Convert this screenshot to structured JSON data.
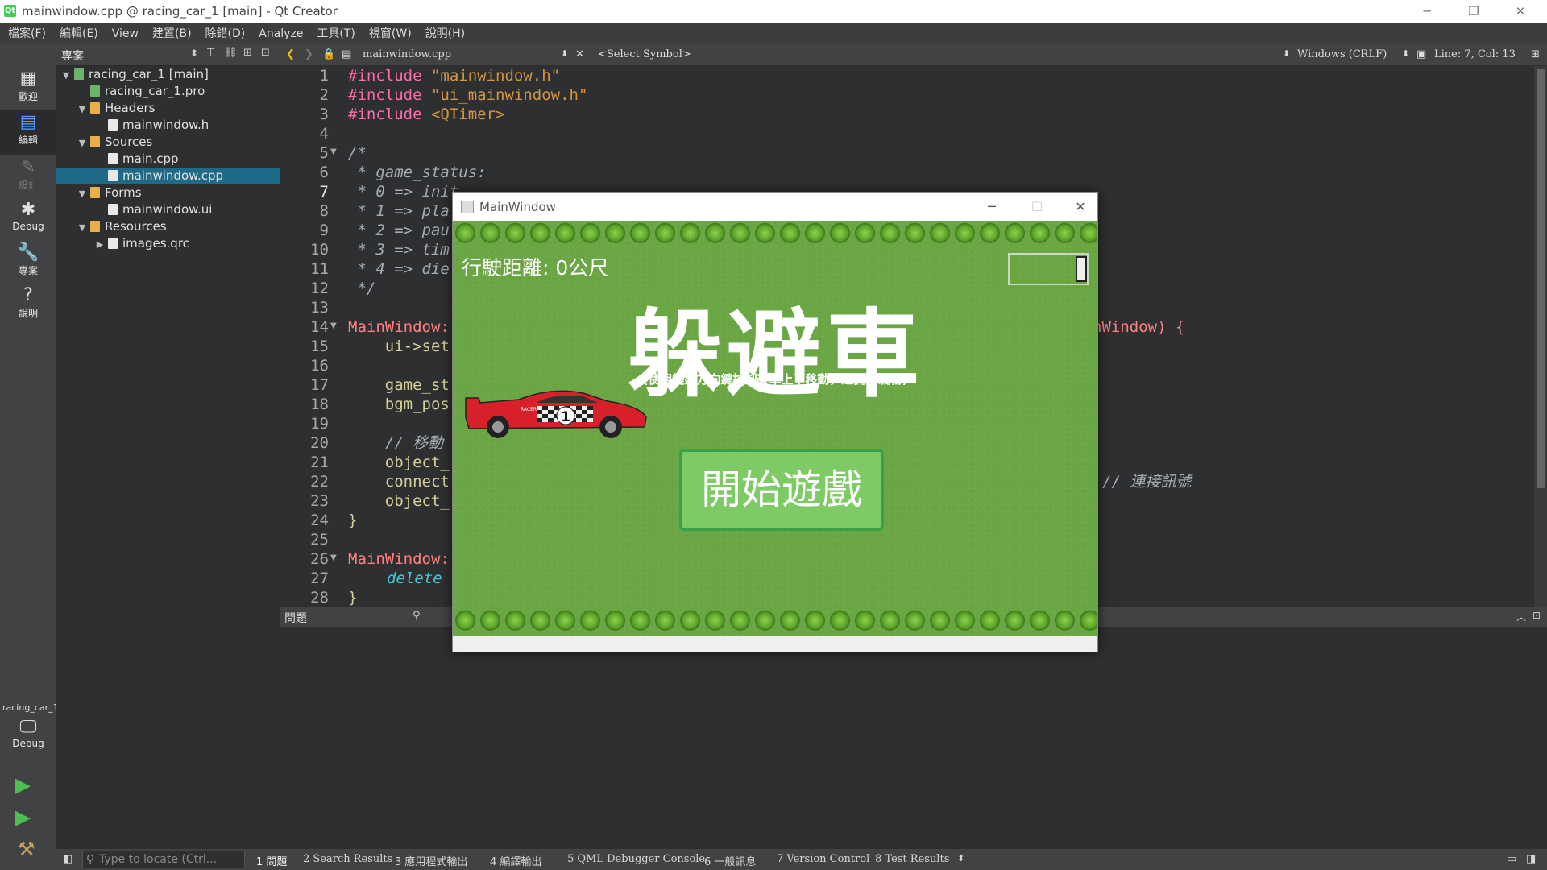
{
  "window": {
    "title": "mainwindow.cpp @ racing_car_1 [main] - Qt Creator",
    "app_icon": "qt-creator-icon"
  },
  "menu": [
    "檔案(F)",
    "編輯(E)",
    "View",
    "建置(B)",
    "除錯(D)",
    "Analyze",
    "工具(T)",
    "視窗(W)",
    "說明(H)"
  ],
  "modes": [
    {
      "label": "歡迎",
      "icon": "grid-icon"
    },
    {
      "label": "編輯",
      "icon": "edit-icon"
    },
    {
      "label": "設計",
      "icon": "design-icon"
    },
    {
      "label": "Debug",
      "icon": "bug-icon"
    },
    {
      "label": "專案",
      "icon": "wrench-icon"
    },
    {
      "label": "說明",
      "icon": "help-icon"
    }
  ],
  "kit": {
    "project": "racing_car_1",
    "label": "Debug"
  },
  "project_panel": {
    "title": "專案"
  },
  "tree": [
    {
      "label": "racing_car_1 [main]",
      "arrow": "▼",
      "icon": "pro"
    },
    {
      "label": "racing_car_1.pro",
      "arrow": "",
      "icon": "pro"
    },
    {
      "label": "Headers",
      "arrow": "▼",
      "icon": "folder"
    },
    {
      "label": "mainwindow.h",
      "arrow": "",
      "icon": "file"
    },
    {
      "label": "Sources",
      "arrow": "▼",
      "icon": "folder"
    },
    {
      "label": "main.cpp",
      "arrow": "",
      "icon": "file"
    },
    {
      "label": "mainwindow.cpp",
      "arrow": "",
      "icon": "file"
    },
    {
      "label": "Forms",
      "arrow": "▼",
      "icon": "folder"
    },
    {
      "label": "mainwindow.ui",
      "arrow": "",
      "icon": "file"
    },
    {
      "label": "Resources",
      "arrow": "▼",
      "icon": "folder"
    },
    {
      "label": "images.qrc",
      "arrow": "▶",
      "icon": "file"
    }
  ],
  "editor_toolbar": {
    "file": "mainwindow.cpp",
    "symbol": "<Select Symbol>",
    "line_ending": "Windows (CRLF)",
    "position": "Line: 7, Col: 13"
  },
  "line_numbers": [
    "1",
    "2",
    "3",
    "4",
    "5",
    "6",
    "7",
    "8",
    "9",
    "10",
    "11",
    "12",
    "13",
    "14",
    "15",
    "16",
    "17",
    "18",
    "19",
    "20",
    "21",
    "22",
    "23",
    "24",
    "25",
    "26",
    "27",
    "28"
  ],
  "code": {
    "l1a": "#include ",
    "l1b": "\"mainwindow.h\"",
    "l2a": "#include ",
    "l2b": "\"ui_mainwindow.h\"",
    "l3a": "#include ",
    "l3b": "<QTimer>",
    "l5": "/*",
    "l6": " * game_status:",
    "l7": " * 0 => init",
    "l8": " * 1 => pla",
    "l9": " * 2 => pau",
    "l10": " * 3 => tim",
    "l11": " * 4 => die",
    "l12": " */",
    "l14a": "MainWindow:",
    "l14b": "nWindow) {",
    "l15": "    ui->set",
    "l17": "    game_st",
    "l18": "    bgm_pos",
    "l20": "    // 移動",
    "l21": "    object_",
    "l22a": "    connect",
    "l22b": "// 連接訊號",
    "l23": "    object_",
    "l24": "}",
    "l26": "MainWindow:",
    "l27": "delete",
    "l28": "}"
  },
  "output": {
    "title": "問題"
  },
  "status": {
    "locate_placeholder": "Type to locate (Ctrl...",
    "tabs": [
      "1 問題",
      "2 Search Results",
      "3 應用程式輸出",
      "4 編譯輸出",
      "5 QML Debugger Console",
      "6 一般訊息",
      "7 Version Control",
      "8 Test Results"
    ]
  },
  "game": {
    "window_title": "MainWindow",
    "distance": "行駛距離: 0公尺",
    "title": "躲避車",
    "subtitle": "(使用鍵盤方向鍵控制賽車上下移動，避開障礙物)",
    "start_button": "開始遊戲",
    "car_number": "1",
    "car_text": "RACER"
  }
}
